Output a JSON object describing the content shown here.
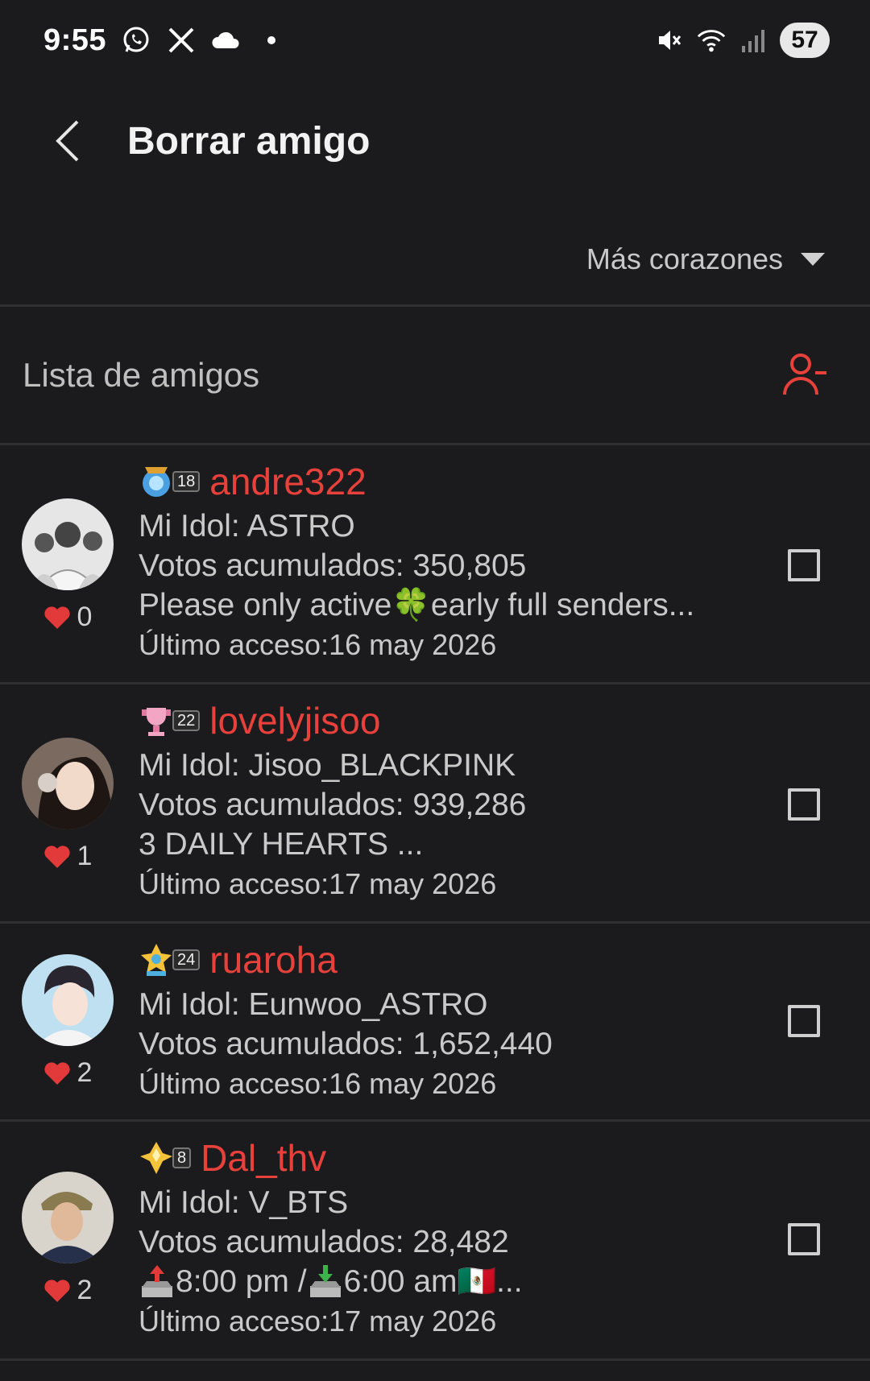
{
  "status_bar": {
    "time": "9:55",
    "battery": "57",
    "icons": [
      "whatsapp-icon",
      "x-icon",
      "cloud-icon",
      "dot-icon",
      "mute-icon",
      "wifi-icon",
      "signal-icon"
    ]
  },
  "header": {
    "title": "Borrar amigo"
  },
  "sort": {
    "label": "Más corazones"
  },
  "list": {
    "title": "Lista de amigos"
  },
  "colors": {
    "accent": "#e8413c",
    "background": "#1b1b1d"
  },
  "friends": [
    {
      "name": "andre322",
      "level": "18",
      "hearts": "0",
      "idol": "Mi Idol: ASTRO",
      "votes": "Votos acumulados: 350,805",
      "status_a": "Please only active",
      "status_emoji": "🍀",
      "status_b": "early full senders...",
      "last": "Último acceso:16 may 2026"
    },
    {
      "name": "lovelyjisoo",
      "level": "22",
      "hearts": "1",
      "idol": "Mi Idol: Jisoo_BLACKPINK",
      "votes": "Votos acumulados: 939,286",
      "status": "3 DAILY HEARTS ...",
      "last": "Último acceso:17 may 2026"
    },
    {
      "name": "ruaroha",
      "level": "24",
      "hearts": "2",
      "idol": "Mi Idol: Eunwoo_ASTRO",
      "votes": "Votos acumulados: 1,652,440",
      "last": "Último acceso:16 may 2026"
    },
    {
      "name": "Dal_thv",
      "level": "8",
      "hearts": "2",
      "idol": "Mi Idol: V_BTS",
      "votes": "Votos acumulados: 28,482",
      "status_time1": "8:00 pm / ",
      "status_time2": "6:00 am ",
      "status_flag": "🇲🇽",
      "status_end": "...",
      "last": "Último acceso:17 may 2026"
    }
  ]
}
